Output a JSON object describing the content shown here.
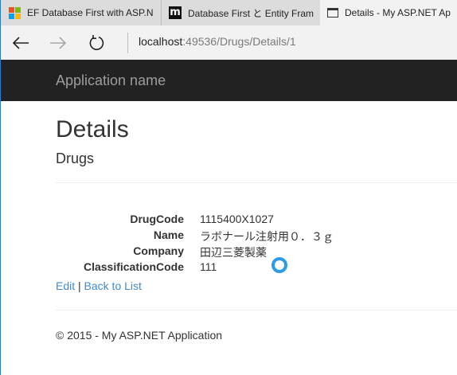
{
  "browser": {
    "tabs": [
      {
        "title": "EF Database First with ASP.N",
        "icon": "microsoft-logo-icon"
      },
      {
        "title": "Database First と Entity Fram",
        "icon": "m-logo-icon"
      },
      {
        "title": "Details - My ASP.NET Ap",
        "icon": "page-icon",
        "active": true
      }
    ],
    "address": {
      "host": "localhost",
      "rest": ":49536/Drugs/Details/1"
    }
  },
  "site": {
    "brand": "Application name"
  },
  "page": {
    "title": "Details",
    "subtitle": "Drugs",
    "fields": [
      {
        "label": "DrugCode",
        "value": "1115400X1027"
      },
      {
        "label": "Name",
        "value": "ラボナール注射用０．３ｇ"
      },
      {
        "label": "Company",
        "value": "田辺三菱製薬"
      },
      {
        "label": "ClassificationCode",
        "value": "111"
      }
    ],
    "actions": {
      "edit": "Edit",
      "separator": "|",
      "back": "Back to List"
    },
    "footer": "© 2015 - My ASP.NET Application"
  },
  "colors": {
    "header_bg": "#222222",
    "brand_text": "#9d9d9d",
    "link": "#428bca",
    "spinner": "#2d9be8"
  }
}
